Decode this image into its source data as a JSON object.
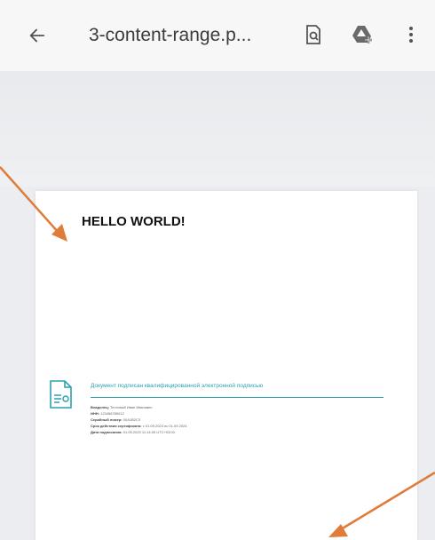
{
  "toolbar": {
    "title": "3-content-range.p...",
    "back_icon": "arrow-left-icon",
    "icons": [
      "file-search-icon",
      "drive-add-icon",
      "more-vert-icon"
    ]
  },
  "document": {
    "heading": "HELLO WORLD!",
    "signature": {
      "title": "Документ подписан квалифицированной электронной подписью",
      "rows": [
        {
          "label": "Владелец:",
          "value": "Тестовый Иван Иванович"
        },
        {
          "label": "ИНН:",
          "value": "123456789012"
        },
        {
          "label": "Серийный номер:",
          "value": "00A1B2C3"
        },
        {
          "label": "Срок действия сертификата:",
          "value": "с 01.09.2023 по 01.09.2024"
        },
        {
          "label": "Дата подписания:",
          "value": "01.09.2023 11:14:05 UTC+03:00"
        }
      ]
    }
  },
  "colors": {
    "accent": "#2aa2b0",
    "annotation_arrow": "#e07b39"
  }
}
